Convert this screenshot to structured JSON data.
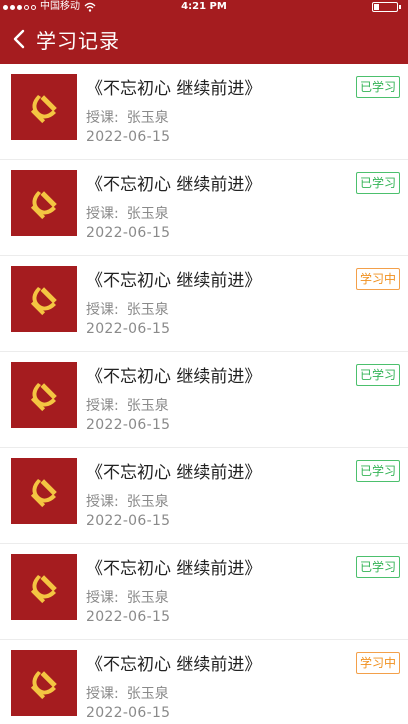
{
  "status_bar": {
    "carrier": "中国移动",
    "time": "4:21 PM"
  },
  "header": {
    "title": "学习记录",
    "back_icon": "chevron-left-icon"
  },
  "colors": {
    "brand_red": "#a51c1f",
    "done_green": "#34b356",
    "learning_orange": "#f0901e"
  },
  "records": [
    {
      "title": "《不忘初心  继续前进》",
      "teacher_label": "授课:",
      "teacher": "张玉泉",
      "date": "2022-06-15",
      "status": "已学习",
      "status_type": "done"
    },
    {
      "title": "《不忘初心  继续前进》",
      "teacher_label": "授课:",
      "teacher": "张玉泉",
      "date": "2022-06-15",
      "status": "已学习",
      "status_type": "done"
    },
    {
      "title": "《不忘初心  继续前进》",
      "teacher_label": "授课:",
      "teacher": "张玉泉",
      "date": "2022-06-15",
      "status": "学习中",
      "status_type": "learning"
    },
    {
      "title": "《不忘初心  继续前进》",
      "teacher_label": "授课:",
      "teacher": "张玉泉",
      "date": "2022-06-15",
      "status": "已学习",
      "status_type": "done"
    },
    {
      "title": "《不忘初心  继续前进》",
      "teacher_label": "授课:",
      "teacher": "张玉泉",
      "date": "2022-06-15",
      "status": "已学习",
      "status_type": "done"
    },
    {
      "title": "《不忘初心  继续前进》",
      "teacher_label": "授课:",
      "teacher": "张玉泉",
      "date": "2022-06-15",
      "status": "已学习",
      "status_type": "done"
    },
    {
      "title": "《不忘初心  继续前进》",
      "teacher_label": "授课:",
      "teacher": "张玉泉",
      "date": "2022-06-15",
      "status": "学习中",
      "status_type": "learning"
    }
  ]
}
